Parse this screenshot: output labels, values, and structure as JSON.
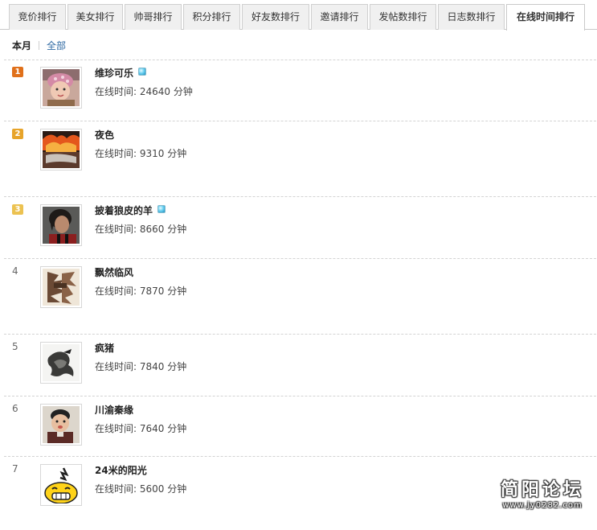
{
  "tabs": [
    {
      "label": "竞价排行",
      "active": false
    },
    {
      "label": "美女排行",
      "active": false
    },
    {
      "label": "帅哥排行",
      "active": false
    },
    {
      "label": "积分排行",
      "active": false
    },
    {
      "label": "好友数排行",
      "active": false
    },
    {
      "label": "邀请排行",
      "active": false
    },
    {
      "label": "发帖数排行",
      "active": false
    },
    {
      "label": "日志数排行",
      "active": false
    },
    {
      "label": "在线时间排行",
      "active": true
    }
  ],
  "subtabs": {
    "current": "本月",
    "other": "全部"
  },
  "stat_label": "在线时间:",
  "stat_unit": "分钟",
  "rank_colors": [
    "#e0701a",
    "#e7a42a",
    "#ecc251"
  ],
  "users": [
    {
      "rank": "1",
      "name": "维珍可乐",
      "online": true,
      "time": "24640",
      "avatar": "baby-photo"
    },
    {
      "rank": "2",
      "name": "夜色",
      "online": false,
      "time": "9310",
      "avatar": "fire-photo"
    },
    {
      "rank": "3",
      "name": "披着狼皮的羊",
      "online": true,
      "time": "8660",
      "avatar": "man-photo"
    },
    {
      "rank": "4",
      "name": "飘然临风",
      "online": false,
      "time": "7870",
      "avatar": "calligraphy-photo"
    },
    {
      "rank": "5",
      "name": "疯猪",
      "online": false,
      "time": "7840",
      "avatar": "ink-figure-photo"
    },
    {
      "rank": "6",
      "name": "川渝秦缘",
      "online": false,
      "time": "7640",
      "avatar": "child-photo"
    },
    {
      "rank": "7",
      "name": "24米的阳光",
      "online": false,
      "time": "5600",
      "avatar": "smiley-cartoon"
    }
  ],
  "watermark": {
    "title": "简阳论坛",
    "url": "www.jy0282.com"
  }
}
